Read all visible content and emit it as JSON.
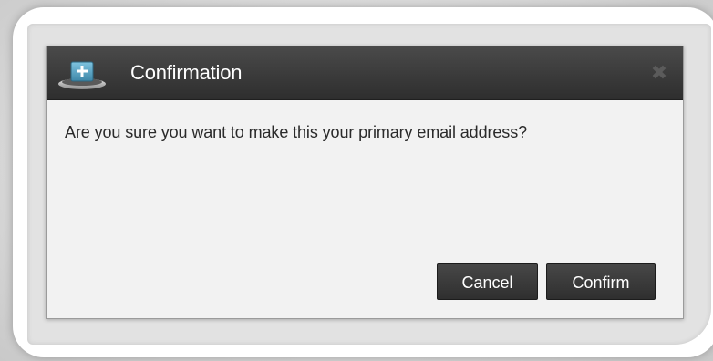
{
  "dialog": {
    "title": "Confirmation",
    "close_glyph": "✖",
    "message": "Are you sure you want to make this your primary email address?",
    "buttons": {
      "cancel_label": "Cancel",
      "confirm_label": "Confirm"
    },
    "icon": "add-tray-icon"
  },
  "colors": {
    "titlebar": "#333333",
    "dialog_body": "#f2f2f2",
    "button": "#3a3a3a",
    "icon_accent": "#5aa5c6"
  }
}
